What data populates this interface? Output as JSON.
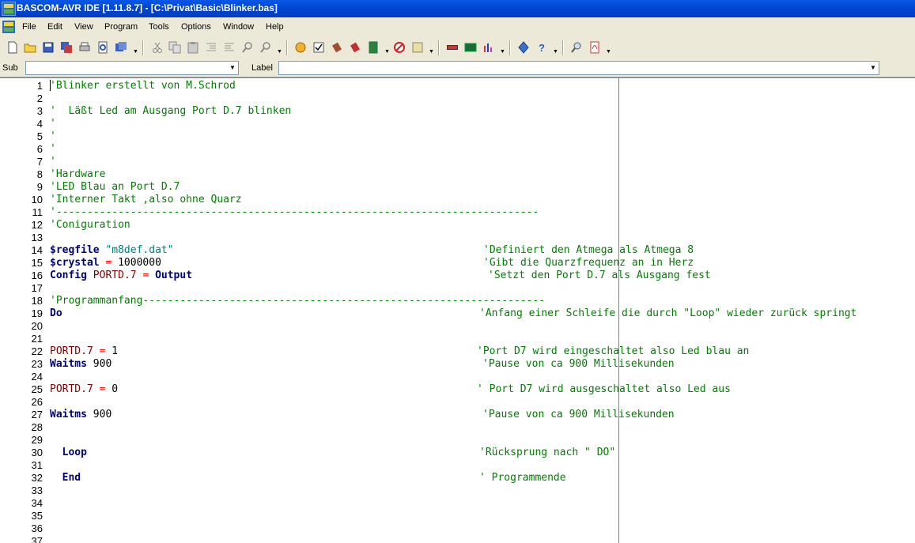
{
  "window": {
    "title": "BASCOM-AVR IDE [1.11.8.7] - [C:\\Privat\\Basic\\Blinker.bas]",
    "colors": {
      "titlebar": "#0047d4",
      "chrome": "#ece9d8",
      "comment": "#008000",
      "keyword": "#000080",
      "string": "#008080",
      "variable": "#800000",
      "operator": "#ff0000"
    }
  },
  "menu": {
    "items": [
      {
        "label": "File"
      },
      {
        "label": "Edit"
      },
      {
        "label": "View"
      },
      {
        "label": "Program"
      },
      {
        "label": "Tools"
      },
      {
        "label": "Options"
      },
      {
        "label": "Window"
      },
      {
        "label": "Help"
      }
    ]
  },
  "toolbar": {
    "icons": [
      "new-file-icon",
      "open-file-icon",
      "save-icon",
      "save-as-icon",
      "print-icon",
      "print-preview-icon",
      "save-all-icon",
      "cut-icon",
      "copy-icon",
      "paste-icon",
      "indent-icon",
      "outdent-icon",
      "find-icon",
      "find-replace-icon",
      "compile-icon",
      "syntax-check-icon",
      "chip-icon",
      "chip2-icon",
      "program-chip-icon",
      "stop-icon",
      "terminal-icon",
      "lcd-icon",
      "lcd-designer-icon",
      "bar-chart-icon",
      "pin-icon",
      "help-icon",
      "zoom-icon",
      "pdf-icon"
    ]
  },
  "subbar": {
    "sub_label": "Sub",
    "label_label": "Label",
    "sub_value": "",
    "label_value": ""
  },
  "editor": {
    "lines": [
      {
        "n": "1",
        "segs": [
          {
            "t": "'Blinker erstellt von M.Schrod",
            "c": "comment"
          }
        ]
      },
      {
        "n": "2",
        "segs": []
      },
      {
        "n": "3",
        "segs": [
          {
            "t": "'  Läßt Led am Ausgang Port D.7 blinken",
            "c": "comment"
          }
        ]
      },
      {
        "n": "4",
        "segs": [
          {
            "t": "'",
            "c": "comment"
          }
        ]
      },
      {
        "n": "5",
        "segs": [
          {
            "t": "'",
            "c": "comment"
          }
        ]
      },
      {
        "n": "6",
        "segs": [
          {
            "t": "'",
            "c": "comment"
          }
        ]
      },
      {
        "n": "7",
        "segs": [
          {
            "t": "'",
            "c": "comment"
          }
        ]
      },
      {
        "n": "8",
        "segs": [
          {
            "t": "'Hardware",
            "c": "comment"
          }
        ]
      },
      {
        "n": "9",
        "segs": [
          {
            "t": "'LED Blau an Port D.7",
            "c": "comment"
          }
        ]
      },
      {
        "n": "10",
        "segs": [
          {
            "t": "'Interner Takt ,also ohne Quarz",
            "c": "comment"
          }
        ]
      },
      {
        "n": "11",
        "segs": [
          {
            "t": "'------------------------------------------------------------------------------",
            "c": "comment"
          }
        ]
      },
      {
        "n": "12",
        "segs": [
          {
            "t": "'Coniguration",
            "c": "comment"
          }
        ]
      },
      {
        "n": "13",
        "segs": []
      },
      {
        "n": "14",
        "segs": [
          {
            "t": "$regfile",
            "c": "kw"
          },
          {
            "t": " ",
            "c": "plain"
          },
          {
            "t": "\"m8def.dat\"",
            "c": "str"
          }
        ],
        "comment": "'Definiert den Atmega als Atmega 8",
        "cpos": "a"
      },
      {
        "n": "15",
        "segs": [
          {
            "t": "$crystal",
            "c": "kw"
          },
          {
            "t": " ",
            "c": "plain"
          },
          {
            "t": "=",
            "c": "op"
          },
          {
            "t": " 1000000",
            "c": "num"
          }
        ],
        "comment": "'Gibt die Quarzfrequenz an in Herz",
        "cpos": "a"
      },
      {
        "n": "16",
        "segs": [
          {
            "t": "Config",
            "c": "kw"
          },
          {
            "t": " ",
            "c": "plain"
          },
          {
            "t": "PORTD.7",
            "c": "var"
          },
          {
            "t": " ",
            "c": "plain"
          },
          {
            "t": "=",
            "c": "op"
          },
          {
            "t": " ",
            "c": "plain"
          },
          {
            "t": "Output",
            "c": "kw"
          }
        ],
        "comment": "'Setzt den Port D.7 als Ausgang fest",
        "cpos": "b"
      },
      {
        "n": "17",
        "segs": []
      },
      {
        "n": "18",
        "segs": [
          {
            "t": "'Programmanfang-----------------------------------------------------------------",
            "c": "comment"
          }
        ]
      },
      {
        "n": "19",
        "segs": [
          {
            "t": "Do",
            "c": "kw"
          }
        ],
        "comment": "'Anfang einer Schleife die durch \"Loop\" wieder zurück springt",
        "cpos": "c"
      },
      {
        "n": "20",
        "segs": []
      },
      {
        "n": "21",
        "segs": []
      },
      {
        "n": "22",
        "segs": [
          {
            "t": "PORTD.7",
            "c": "var"
          },
          {
            "t": " ",
            "c": "plain"
          },
          {
            "t": "=",
            "c": "op"
          },
          {
            "t": " 1",
            "c": "num"
          }
        ],
        "comment": "'Port D7 wird eingeschaltet also Led blau an",
        "cpos": "d"
      },
      {
        "n": "23",
        "segs": [
          {
            "t": "Waitms",
            "c": "kw"
          },
          {
            "t": " 900",
            "c": "num"
          }
        ],
        "comment": "'Pause von ca 900 Millisekunden",
        "cpos": "e"
      },
      {
        "n": "24",
        "segs": []
      },
      {
        "n": "25",
        "segs": [
          {
            "t": "PORTD.7",
            "c": "var"
          },
          {
            "t": " ",
            "c": "plain"
          },
          {
            "t": "=",
            "c": "op"
          },
          {
            "t": " 0",
            "c": "num"
          }
        ],
        "comment": "' Port D7 wird ausgeschaltet also Led aus",
        "cpos": "d"
      },
      {
        "n": "26",
        "segs": []
      },
      {
        "n": "27",
        "segs": [
          {
            "t": "Waitms",
            "c": "kw"
          },
          {
            "t": " 900",
            "c": "num"
          }
        ],
        "comment": "'Pause von ca 900 Millisekunden",
        "cpos": "e"
      },
      {
        "n": "28",
        "segs": []
      },
      {
        "n": "29",
        "segs": []
      },
      {
        "n": "30",
        "segs": [
          {
            "t": "  ",
            "c": "plain"
          },
          {
            "t": "Loop",
            "c": "kw"
          }
        ],
        "comment": "'Rücksprung nach \" DO\"",
        "cpos": "c"
      },
      {
        "n": "31",
        "segs": []
      },
      {
        "n": "32",
        "segs": [
          {
            "t": "  ",
            "c": "plain"
          },
          {
            "t": "End",
            "c": "kw"
          }
        ],
        "comment": "' Programmende",
        "cpos": "c"
      },
      {
        "n": "33",
        "segs": []
      },
      {
        "n": "34",
        "segs": []
      },
      {
        "n": "35",
        "segs": []
      },
      {
        "n": "36",
        "segs": []
      },
      {
        "n": "37",
        "segs": []
      }
    ]
  }
}
